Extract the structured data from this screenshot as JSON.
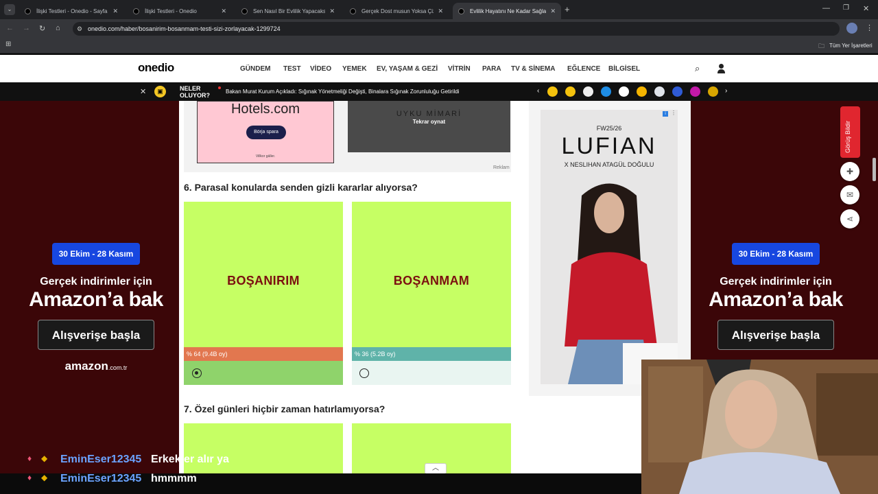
{
  "browser": {
    "tabs": [
      {
        "label": "İlişki Testleri - Onedio - Sayfa 4"
      },
      {
        "label": "İlişki Testleri - Onedio"
      },
      {
        "label": "Sen Nasıl Bir Evlilik Yapacaksın?"
      },
      {
        "label": "Gerçek Dost musun Yoksa Çizgi"
      },
      {
        "label": "Evlilik Hayatını Ne Kadar Sağlam"
      }
    ],
    "url": "onedio.com/haber/bosanirim-bosanmam-testi-sizi-zorlayacak-1299724",
    "bookmarks_label": "Tüm Yer İşaretleri"
  },
  "site": {
    "logo": "onedio",
    "nav": [
      "GÜNDEM",
      "TEST",
      "VİDEO",
      "YEMEK",
      "EV, YAŞAM & GEZİ",
      "VİTRİN",
      "PARA",
      "TV & SİNEMA",
      "EĞLENCE",
      "BİLGİSEL"
    ],
    "ticker_label": "NELER OLUYOR?",
    "ticker_text": "Bakan Murat Kurum Açıkladı: Sığınak Yönetmeliği Değişti, Binalara Sığınak Zorunluluğu Getirildi"
  },
  "ads": {
    "hotels_brand": "Hotels.com",
    "hotels_button": "Börja spara",
    "hotels_small": "Villkor gäller.",
    "uyku_text": "UYKU MİMARİ",
    "replay_label": "Tekrar oynat",
    "reklam_label": "Reklam",
    "lufian_season": "FW25/26",
    "lufian_brand": "LUFIAN",
    "lufian_sub": "X NESLIHAN ATAGÜL DOĞULU",
    "amazon_dates": "30 Ekim - 28 Kasım",
    "amazon_line1": "Gerçek indirimler için",
    "amazon_line2": "Amazon’a bak",
    "amazon_button": "Alışverişe başla",
    "amazon_logo": "amazon",
    "amazon_domain": ".com.tr"
  },
  "quiz": {
    "q6": "6. Parasal konularda senden gizli kararlar alıyorsa?",
    "q7": "7. Özel günleri hiçbir zaman hatırlamıyorsa?",
    "options": [
      {
        "label": "BOŞANIRIM",
        "result": "% 64 (9.4B oy)",
        "percent": 64,
        "selected": true,
        "bar_color": "#e2774f"
      },
      {
        "label": "BOŞANMAM",
        "result": "% 36 (5.2B oy)",
        "percent": 36,
        "selected": false,
        "bar_color": "#5fb3a9"
      }
    ]
  },
  "feedback_label": "Görüş Bildir",
  "chat": [
    {
      "user": "EminEser12345",
      "message": "Erkekler alır ya"
    },
    {
      "user": "EminEser12345",
      "message": "hmmmm"
    }
  ]
}
